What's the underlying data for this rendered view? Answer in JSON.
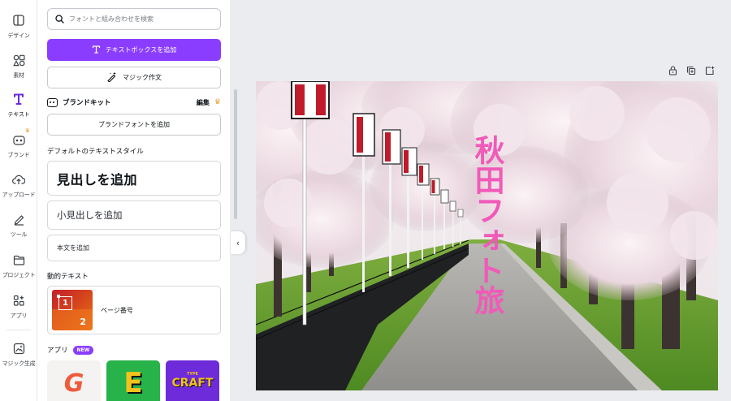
{
  "rail": {
    "items": [
      {
        "label": "デザイン",
        "icon": "layout-icon"
      },
      {
        "label": "素材",
        "icon": "elements-icon"
      },
      {
        "label": "テキスト",
        "icon": "text-icon"
      },
      {
        "label": "ブランド",
        "icon": "brand-icon"
      },
      {
        "label": "アップロード",
        "icon": "upload-icon"
      },
      {
        "label": "ツール",
        "icon": "draw-icon"
      },
      {
        "label": "プロジェクト",
        "icon": "folder-icon"
      },
      {
        "label": "アプリ",
        "icon": "apps-icon"
      },
      {
        "label": "マジック生成",
        "icon": "magic-media-icon"
      }
    ]
  },
  "panel": {
    "search_placeholder": "フォントと組み合わせを検索",
    "add_textbox": "テキストボックスを追加",
    "magic_write": "マジック作文",
    "brand_kit": {
      "title": "ブランドキット",
      "edit": "編集"
    },
    "add_brand_font": "ブランドフォントを追加",
    "default_styles_label": "デフォルトのテキストスタイル",
    "heading": "見出しを追加",
    "subheading": "小見出しを追加",
    "body": "本文を追加",
    "dynamic_label": "動的テキスト",
    "page_number": "ページ番号",
    "page_number_thumb": {
      "first": "1",
      "second": "2"
    },
    "apps_label": "アプリ",
    "apps_badge": "NEW",
    "app_tiles": [
      {
        "name": "app-tile-gradient-g",
        "text": "G"
      },
      {
        "name": "app-tile-e",
        "text": "E"
      },
      {
        "name": "app-tile-craft",
        "text": "CRAFT",
        "small": "TYPE"
      }
    ]
  },
  "canvas": {
    "overlay_text": "秋田フォト旅",
    "overlay_color": "#f05ab8"
  },
  "colors": {
    "primary": "#8b3dff",
    "crown": "#e8a23a"
  }
}
